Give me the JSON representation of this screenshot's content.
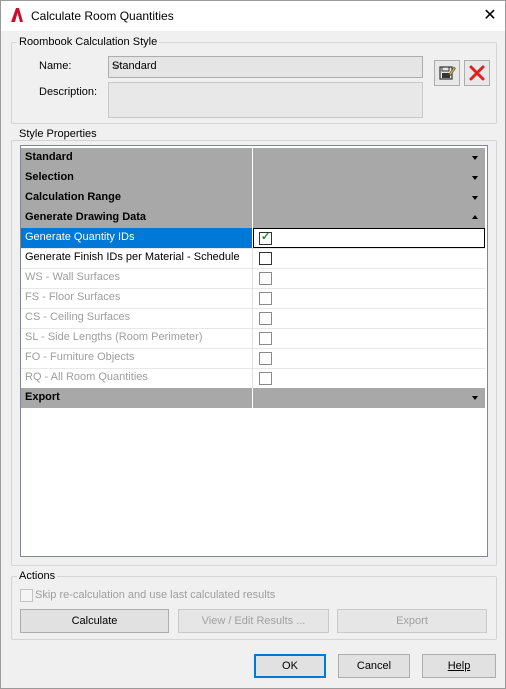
{
  "window": {
    "title": "Calculate Room Quantities"
  },
  "roombook": {
    "legend": "Roombook Calculation Style",
    "name_label": "Name:",
    "name_value": "Standard",
    "description_label": "Description:"
  },
  "style_properties": {
    "legend": "Style Properties",
    "categories": {
      "standard": "Standard",
      "selection": "Selection",
      "calculation_range": "Calculation Range",
      "generate_drawing_data": "Generate Drawing Data",
      "export": "Export"
    },
    "properties": [
      {
        "name": "Generate Quantity IDs",
        "checked": true,
        "enabled": true,
        "selected": true
      },
      {
        "name": "Generate Finish IDs per Material - Schedule",
        "checked": false,
        "enabled": true,
        "selected": false
      },
      {
        "name": "WS - Wall Surfaces",
        "checked": false,
        "enabled": false
      },
      {
        "name": "FS - Floor Surfaces",
        "checked": false,
        "enabled": false
      },
      {
        "name": "CS - Ceiling Surfaces",
        "checked": false,
        "enabled": false
      },
      {
        "name": "SL - Side Lengths (Room Perimeter)",
        "checked": false,
        "enabled": false
      },
      {
        "name": "FO - Furniture Objects",
        "checked": false,
        "enabled": false
      },
      {
        "name": "RQ - All Room Quantities",
        "checked": false,
        "enabled": false
      }
    ]
  },
  "actions": {
    "legend": "Actions",
    "skip_label": "Skip re-calculation and use last calculated results",
    "calculate": "Calculate",
    "view_edit": "View / Edit Results ...",
    "export": "Export"
  },
  "footer": {
    "ok": "OK",
    "cancel": "Cancel",
    "help": "Help"
  },
  "colors": {
    "selection": "#0078d7",
    "category": "#a8a8a8",
    "delete": "#e02020"
  }
}
